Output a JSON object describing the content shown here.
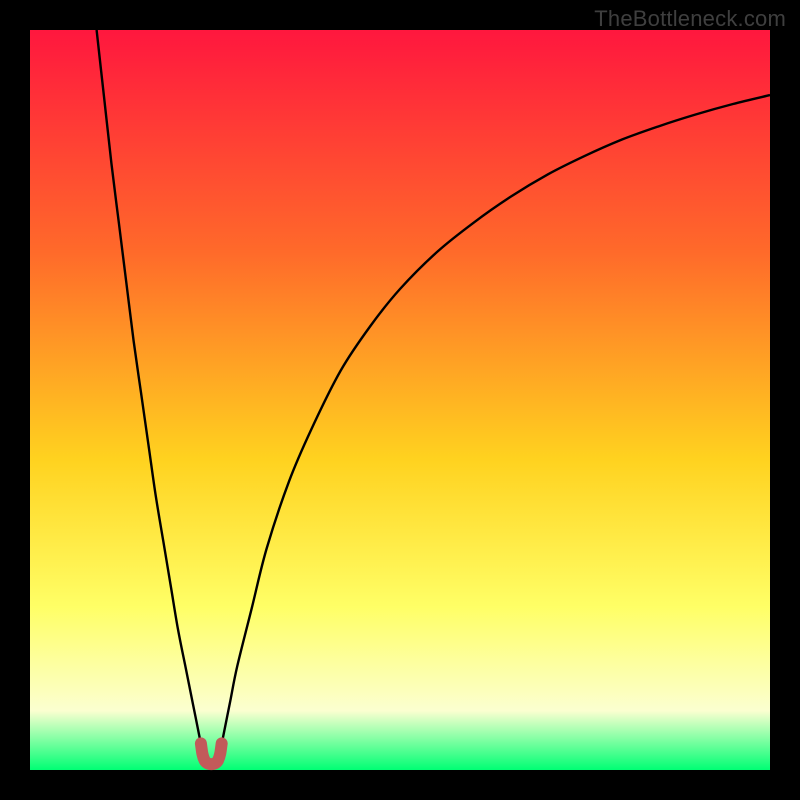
{
  "watermark": "TheBottleneck.com",
  "colors": {
    "frame": "#000000",
    "grad_top": "#ff173e",
    "grad_mid1": "#ff6a2a",
    "grad_mid2": "#ffd21f",
    "grad_mid3": "#ffff66",
    "grad_low": "#fbffd0",
    "grad_bottom": "#00ff74",
    "curve": "#000000",
    "marker": "#c25a5a"
  },
  "chart_data": {
    "type": "line",
    "title": "",
    "xlabel": "",
    "ylabel": "",
    "xlim": [
      0,
      100
    ],
    "ylim": [
      0,
      100
    ],
    "series": [
      {
        "name": "curve-left",
        "x": [
          9,
          10,
          11,
          12,
          13,
          14,
          15,
          16,
          17,
          18,
          19,
          20,
          21,
          22,
          23,
          23.5
        ],
        "values": [
          100,
          91,
          82,
          74,
          66,
          58,
          51,
          44,
          37,
          31,
          25,
          19,
          14,
          9,
          4,
          1.3
        ]
      },
      {
        "name": "curve-right",
        "x": [
          25.5,
          26,
          27,
          28,
          30,
          32,
          35,
          38,
          42,
          46,
          50,
          55,
          60,
          65,
          70,
          75,
          80,
          85,
          90,
          95,
          100
        ],
        "values": [
          1.3,
          4,
          9,
          14,
          22,
          30,
          39,
          46,
          54,
          60,
          65,
          70,
          74,
          77.5,
          80.5,
          83,
          85.2,
          87,
          88.6,
          90,
          91.2
        ]
      },
      {
        "name": "marker-u",
        "x": [
          23.1,
          23.3,
          23.6,
          24.0,
          24.5,
          25.0,
          25.4,
          25.7,
          25.9
        ],
        "values": [
          3.6,
          2.2,
          1.3,
          0.9,
          0.8,
          0.9,
          1.3,
          2.2,
          3.6
        ]
      }
    ],
    "annotations": []
  }
}
